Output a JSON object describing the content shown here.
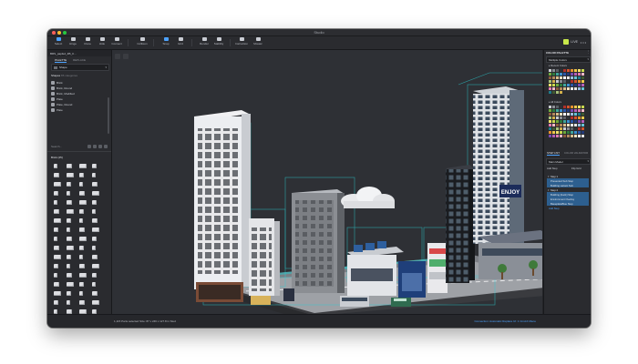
{
  "window": {
    "title": "Studio"
  },
  "toolbar": {
    "items": [
      "Select",
      "Hinge",
      "Clone",
      "Hide",
      "Connect",
      "Collision",
      "Snap",
      "Grid",
      "Render",
      "Stability",
      "Instruction",
      "Mosaic"
    ],
    "live_label": "LIVE"
  },
  "left_panel": {
    "file_tab": "BRS_papfed_ZB_0…",
    "subtabs": [
      "PALETTE",
      "REPLACE"
    ],
    "palette_select": "Shape",
    "shapes_heading": "Shapes",
    "shapes_count": "86 categories",
    "shape_items": [
      "Brick",
      "Brick, Round",
      "Brick, Modified",
      "Plate",
      "Plate, Round",
      "Plate"
    ],
    "search_placeholder": "Search...",
    "brick_section": "Brick (25)",
    "round_section": "Brick, Round (16)"
  },
  "right_panel": {
    "header": "COLOR PALETTE",
    "palette_select": "Multiple Colors",
    "recent_label": "Recent Colors",
    "all_label": "All Colors",
    "tabs": [
      "STEP LIST",
      "COLOR VALIDATOR"
    ],
    "view_select": "Main Model",
    "add_step": "Add Step",
    "flip_label": "Flip Grid",
    "steps": [
      "Step 1",
      "Presented Sub Step",
      "Building variant Sub",
      "Step 2",
      "Building (back) Step",
      "Environment Overlay",
      "BaseplateBlue Step",
      "Add Step"
    ],
    "colors": {
      "swatches": [
        "#c8cbd0",
        "#8a8d93",
        "#5b5e64",
        "#2e3136",
        "#b0302a",
        "#d4542c",
        "#e8912e",
        "#f0c94a",
        "#f3e36a",
        "#c9d84d",
        "#6ea93c",
        "#2f7a3d",
        "#3ea59b",
        "#3a8fd0",
        "#2b56a8",
        "#233a78",
        "#7a4bb0",
        "#b65fb8",
        "#e07ab0",
        "#f4b8c8",
        "#8a5a3c",
        "#b48a5c",
        "#d9bf8c",
        "#f1e2c2",
        "#ffffff",
        "#e6e6e6",
        "#9cbfe0",
        "#66c2d6",
        "#1e7b8a",
        "#3f5a30",
        "#a9c27a",
        "#d3b04b"
      ]
    }
  },
  "statusbar": {
    "left": "1,115 Parts selected   Size: 87 x 246 x 127.8 in Stud",
    "right": "Connection: Automatic   Replace UI: 1   Cmd-K Menu"
  },
  "scene": {
    "billboard_text": "ENJOY"
  }
}
